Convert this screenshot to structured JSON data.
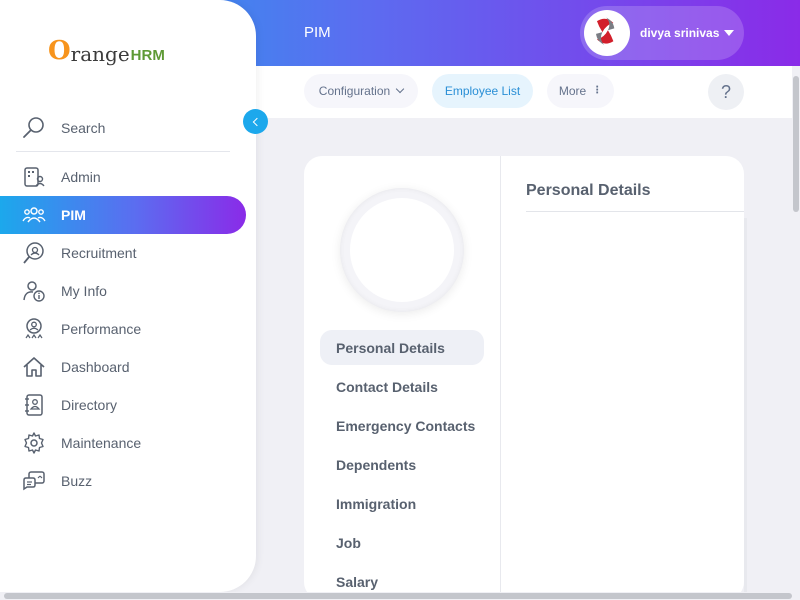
{
  "header": {
    "module_title": "PIM",
    "user_name": "divya srinivas"
  },
  "subnav": {
    "configuration": "Configuration",
    "employee_list": "Employee List",
    "more": "More",
    "help": "?"
  },
  "logo": {
    "o": "O",
    "range": "range",
    "hrm": "HRM"
  },
  "sidebar": {
    "search_label": "Search",
    "items": [
      {
        "label": "Admin"
      },
      {
        "label": "PIM"
      },
      {
        "label": "Recruitment"
      },
      {
        "label": "My Info"
      },
      {
        "label": "Performance"
      },
      {
        "label": "Dashboard"
      },
      {
        "label": "Directory"
      },
      {
        "label": "Maintenance"
      },
      {
        "label": "Buzz"
      }
    ]
  },
  "employee": {
    "tabs": [
      {
        "label": "Personal Details"
      },
      {
        "label": "Contact Details"
      },
      {
        "label": "Emergency Contacts"
      },
      {
        "label": "Dependents"
      },
      {
        "label": "Immigration"
      },
      {
        "label": "Job"
      },
      {
        "label": "Salary"
      }
    ],
    "section_title": "Personal Details"
  },
  "colors": {
    "accent_blue": "#1ca8ec",
    "accent_purple": "#8a2be8",
    "text": "#58616f",
    "logo_orange": "#f7941d",
    "logo_green": "#5e9a35"
  }
}
